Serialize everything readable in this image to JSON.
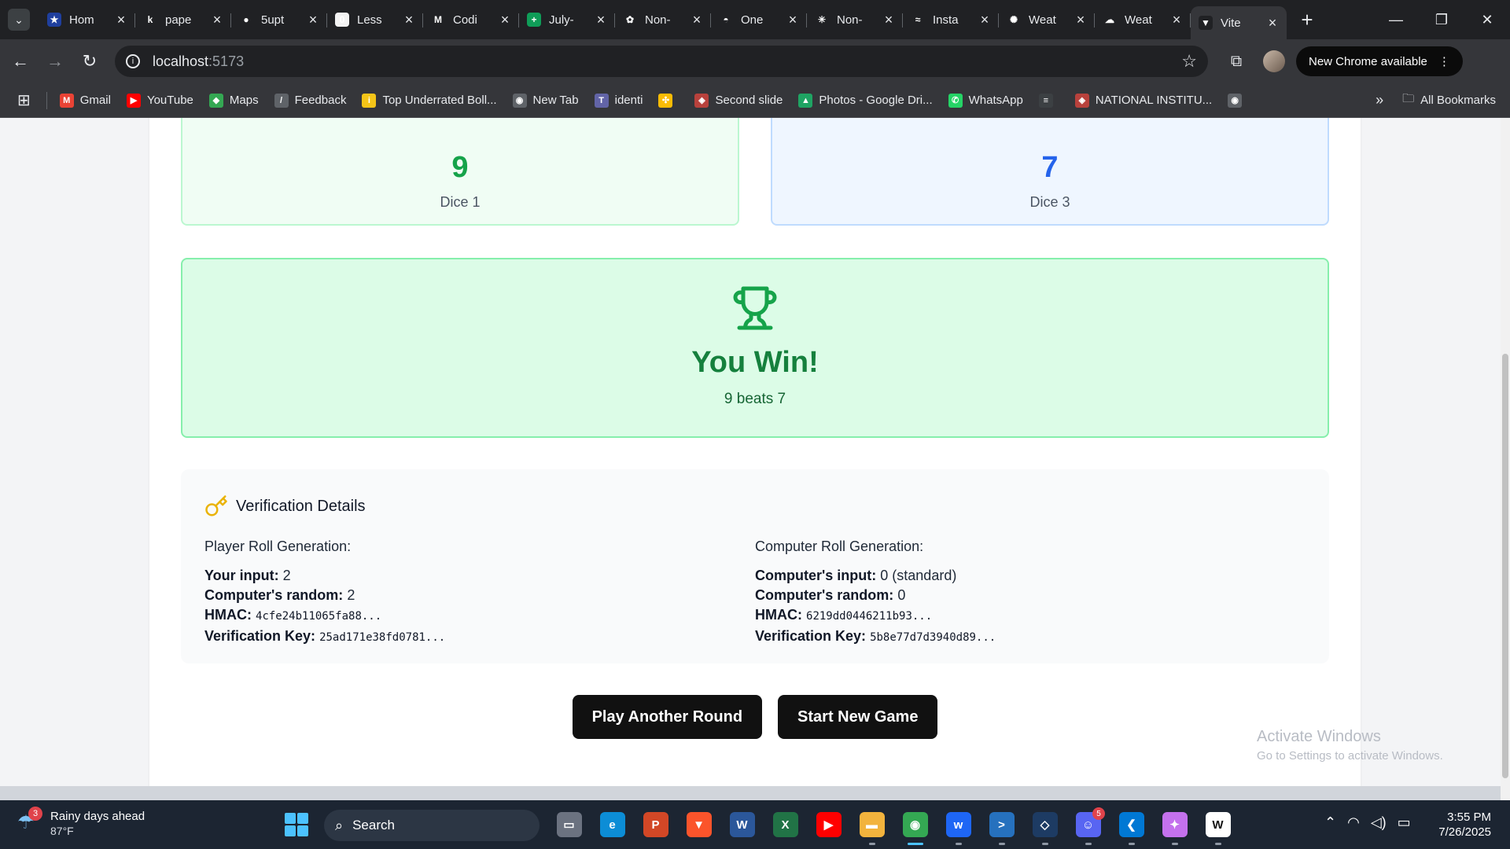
{
  "browser": {
    "tabs": [
      {
        "title": "Hom",
        "favicon": "eu-flag-icon",
        "color": "#1f3f9e",
        "glyph": "★"
      },
      {
        "title": "pape",
        "favicon": "k-logo-icon",
        "color": "#202124",
        "glyph": "k"
      },
      {
        "title": "5upt",
        "favicon": "github-icon",
        "color": "#202124",
        "glyph": "●"
      },
      {
        "title": "Less",
        "favicon": "bag-icon",
        "color": "#f3f3f3",
        "glyph": "0"
      },
      {
        "title": "Codi",
        "favicon": "gmail-icon",
        "color": "#202124",
        "glyph": "M"
      },
      {
        "title": "July-",
        "favicon": "sheets-icon",
        "color": "#0f9d58",
        "glyph": "+"
      },
      {
        "title": "Non-",
        "favicon": "openai-icon",
        "color": "#202124",
        "glyph": "✿"
      },
      {
        "title": "One",
        "favicon": "helmet-icon",
        "color": "#202124",
        "glyph": "◓"
      },
      {
        "title": "Non-",
        "favicon": "claude-icon",
        "color": "#202124",
        "glyph": "✳"
      },
      {
        "title": "Insta",
        "favicon": "tailwind-icon",
        "color": "#202124",
        "glyph": "≈"
      },
      {
        "title": "Weat",
        "favicon": "gear-flower-icon",
        "color": "#202124",
        "glyph": "✺"
      },
      {
        "title": "Weat",
        "favicon": "sun-cloud-icon",
        "color": "#202124",
        "glyph": "☁"
      },
      {
        "title": "Vite",
        "favicon": "vite-icon",
        "color": "#202124",
        "glyph": "▼",
        "active": true
      }
    ],
    "url_host": "localhost",
    "url_port": ":5173",
    "update_label": "New Chrome available",
    "bookmarks": [
      {
        "label": "Gmail",
        "icon": "gmail-icon",
        "color": "#ea4335",
        "glyph": "M"
      },
      {
        "label": "YouTube",
        "icon": "youtube-icon",
        "color": "#ff0000",
        "glyph": "▶"
      },
      {
        "label": "Maps",
        "icon": "maps-icon",
        "color": "#34a853",
        "glyph": "◆"
      },
      {
        "label": "Feedback",
        "icon": "feedback-icon",
        "color": "#5f6368",
        "glyph": "/"
      },
      {
        "label": "Top Underrated Boll...",
        "icon": "imdb-icon",
        "color": "#f5c518",
        "glyph": "i"
      },
      {
        "label": "New Tab",
        "icon": "globe-icon",
        "color": "#5f6368",
        "glyph": "◉"
      },
      {
        "label": "identi",
        "icon": "teams-icon",
        "color": "#6264a7",
        "glyph": "T"
      },
      {
        "label": "",
        "icon": "pinwheel-icon",
        "color": "#fbbc05",
        "glyph": "✣"
      },
      {
        "label": "Second slide",
        "icon": "emblem-icon",
        "color": "#b8413c",
        "glyph": "◈"
      },
      {
        "label": "Photos - Google Dri...",
        "icon": "drive-icon",
        "color": "#1fa463",
        "glyph": "▲"
      },
      {
        "label": "WhatsApp",
        "icon": "whatsapp-icon",
        "color": "#25d366",
        "glyph": "✆"
      },
      {
        "label": "",
        "icon": "notion-icon",
        "color": "#3c4043",
        "glyph": "≡"
      },
      {
        "label": "NATIONAL INSTITU...",
        "icon": "institute-icon",
        "color": "#b8413c",
        "glyph": "◈"
      },
      {
        "label": "",
        "icon": "globe-icon",
        "color": "#5f6368",
        "glyph": "◉"
      }
    ],
    "all_bookmarks_label": "All Bookmarks"
  },
  "game": {
    "dice": [
      {
        "value": "9",
        "label": "Dice 1"
      },
      {
        "value": "7",
        "label": "Dice 3"
      }
    ],
    "result": {
      "title": "You Win!",
      "subtitle": "9 beats 7"
    },
    "verification": {
      "heading": "Verification Details",
      "player": {
        "title": "Player Roll Generation:",
        "input_label": "Your input:",
        "input_value": "2",
        "random_label": "Computer's random:",
        "random_value": "2",
        "hmac_label": "HMAC:",
        "hmac_value": "4cfe24b11065fa88...",
        "key_label": "Verification Key:",
        "key_value": "25ad171e38fd0781..."
      },
      "computer": {
        "title": "Computer Roll Generation:",
        "input_label": "Computer's input:",
        "input_value": "0 (standard)",
        "random_label": "Computer's random:",
        "random_value": "0",
        "hmac_label": "HMAC:",
        "hmac_value": "6219dd0446211b93...",
        "key_label": "Verification Key:",
        "key_value": "5b8e77d7d3940d89..."
      }
    },
    "buttons": {
      "play_again": "Play Another Round",
      "new_game": "Start New Game"
    }
  },
  "watermark": {
    "line1": "Activate Windows",
    "line2": "Go to Settings to activate Windows."
  },
  "taskbar": {
    "weather_title": "Rainy days ahead",
    "weather_temp": "87°F",
    "weather_badge": "3",
    "search_label": "Search",
    "apps": [
      {
        "name": "task-view-icon",
        "color": "#6b7280",
        "glyph": "▭"
      },
      {
        "name": "edge-icon",
        "color": "#0c8dd6",
        "glyph": "e"
      },
      {
        "name": "powerpoint-icon",
        "color": "#d24726",
        "glyph": "P"
      },
      {
        "name": "brave-icon",
        "color": "#fb542b",
        "glyph": "▼"
      },
      {
        "name": "word-icon",
        "color": "#2b579a",
        "glyph": "W"
      },
      {
        "name": "excel-icon",
        "color": "#217346",
        "glyph": "X"
      },
      {
        "name": "youtube-icon",
        "color": "#ff0000",
        "glyph": "▶"
      },
      {
        "name": "file-explorer-icon",
        "color": "#f2b33d",
        "glyph": "▬",
        "running": true
      },
      {
        "name": "chrome-icon",
        "color": "#34a853",
        "glyph": "◉",
        "running": true,
        "active": true
      },
      {
        "name": "windsurf-icon",
        "color": "#1e66f5",
        "glyph": "w",
        "running": true
      },
      {
        "name": "powershell-icon",
        "color": "#2671be",
        "glyph": ">",
        "running": true
      },
      {
        "name": "network-tool-icon",
        "color": "#1d3b63",
        "glyph": "◇",
        "running": true
      },
      {
        "name": "discord-icon",
        "color": "#5865f2",
        "glyph": "☺",
        "badge": "5",
        "running": true
      },
      {
        "name": "vscode-icon",
        "color": "#0078d4",
        "glyph": "❮",
        "running": true
      },
      {
        "name": "copilot-icon",
        "color": "#c471ed",
        "glyph": "✦",
        "running": true
      },
      {
        "name": "notion-app-icon",
        "color": "#ffffff",
        "glyph": "W",
        "running": true
      }
    ],
    "time": "3:55 PM",
    "date": "7/26/2025"
  },
  "colors": {
    "win_green": "#15803d",
    "dice1_green": "#16a34a",
    "dice3_blue": "#2563eb"
  }
}
